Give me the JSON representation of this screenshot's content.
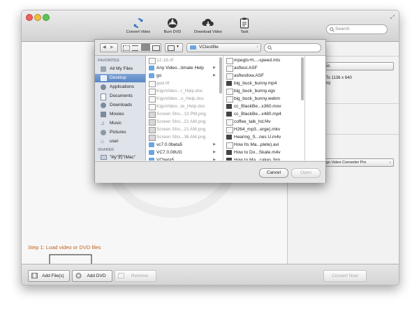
{
  "toolbar": {
    "items": [
      {
        "label": "Convert Video",
        "icon": "refresh-icon"
      },
      {
        "label": "Burn DVD",
        "icon": "disc-icon"
      },
      {
        "label": "Download Video",
        "icon": "cloud-download-icon"
      },
      {
        "label": "Task",
        "icon": "clipboard-icon"
      }
    ],
    "search_placeholder": "Search"
  },
  "dialog": {
    "path_popup": "VCtestfile",
    "sidebar": {
      "favorites_header": "FAVORITES",
      "favorites": [
        {
          "label": "All My Files",
          "icon": "all-files-icon"
        },
        {
          "label": "Desktop",
          "icon": "desktop-icon",
          "selected": true
        },
        {
          "label": "Applications",
          "icon": "applications-icon"
        },
        {
          "label": "Documents",
          "icon": "documents-icon"
        },
        {
          "label": "Downloads",
          "icon": "downloads-icon"
        },
        {
          "label": "Movies",
          "icon": "movies-icon"
        },
        {
          "label": "Music",
          "icon": "music-icon"
        },
        {
          "label": "Pictures",
          "icon": "pictures-icon"
        },
        {
          "label": "user",
          "icon": "home-icon"
        }
      ],
      "shared_header": "SHARED",
      "shared": [
        {
          "label": "\"lily\"的\"iMac\"",
          "icon": "computer-icon"
        }
      ]
    },
    "column1": [
      {
        "label": "12-18.rtf",
        "kind": "doc",
        "gray": true
      },
      {
        "label": "Any Video...timate Help",
        "kind": "folder",
        "arrow": true
      },
      {
        "label": "go",
        "kind": "folder",
        "arrow": true
      },
      {
        "label": "god.rtf",
        "kind": "doc",
        "gray": true
      },
      {
        "label": "KigoVideo...r_Help.doc",
        "kind": "doc",
        "gray": true
      },
      {
        "label": "KigoVideo...o_Help.doc",
        "kind": "doc",
        "gray": true
      },
      {
        "label": "KigoVideo...te_Help.doc",
        "kind": "doc",
        "gray": true
      },
      {
        "label": "Screen Sho...13 PM.png",
        "kind": "img",
        "gray": true
      },
      {
        "label": "Screen Sho...21 AM.png",
        "kind": "img",
        "gray": true
      },
      {
        "label": "Screen Sho...21 AM.png",
        "kind": "img",
        "gray": true
      },
      {
        "label": "Screen Sho...36 AM.png",
        "kind": "img",
        "gray": true
      },
      {
        "label": "vc7.0.0beta5",
        "kind": "folder",
        "arrow": true
      },
      {
        "label": "VC7.0.08UG",
        "kind": "folder",
        "arrow": true
      },
      {
        "label": "VCbeta5",
        "kind": "folder",
        "arrow": true
      },
      {
        "label": "VCtestfile",
        "kind": "folder",
        "arrow": true,
        "selected": true
      },
      {
        "label": "vcu_profile",
        "kind": "folder",
        "arrow": true
      }
    ],
    "column2": [
      {
        "label": "mpegts+h...-speed.mts",
        "kind": "file"
      },
      {
        "label": "asftest.ASF",
        "kind": "file"
      },
      {
        "label": "asftestlow.ASF",
        "kind": "file"
      },
      {
        "label": "big_buck_bunny.mp4",
        "kind": "video"
      },
      {
        "label": "big_buck_bunny.ogv",
        "kind": "file"
      },
      {
        "label": "big_buck_bunny.webm",
        "kind": "file"
      },
      {
        "label": "cc_BlackBe...x360.mov",
        "kind": "video"
      },
      {
        "label": "cc_BlackBe...x480.mp4",
        "kind": "video"
      },
      {
        "label": "coffee_talk_hd.f4v",
        "kind": "file"
      },
      {
        "label": "H264_mp3...erge).mkv",
        "kind": "file"
      },
      {
        "label": "Hearing_S...nes U.m4v",
        "kind": "video"
      },
      {
        "label": "How Its Ma...plete).avi",
        "kind": "file"
      },
      {
        "label": "How to Do...Skate.m4v",
        "kind": "video"
      },
      {
        "label": "How to Ma...cakes.3gp",
        "kind": "video"
      },
      {
        "label": "Miley.Cyru...[wmv].wmv",
        "kind": "file"
      },
      {
        "label": "Miley.Cyru...(wmv).wmv",
        "kind": "file"
      }
    ],
    "cancel_label": "Cancel",
    "open_label": "Open"
  },
  "right_panel": {
    "device_button": "one 5s",
    "info_line1": "ize Up To 1136 x 640",
    "info_line2": "48000 Hz",
    "faded_text": "ideos",
    "section_label": "on",
    "app_select": "Kigo Video Converter Pro"
  },
  "instruction": {
    "step": "Step 1:",
    "text": "Load video or DVD files"
  },
  "bottom": {
    "add_files": "Add File(s)",
    "add_dvd": "Add DVD",
    "remove": "Remove",
    "convert_now": "Convert Now"
  },
  "colors": {
    "accent": "#3875d7",
    "instruction": "#c4611b",
    "sidebar_selected": "#6b96cf"
  }
}
